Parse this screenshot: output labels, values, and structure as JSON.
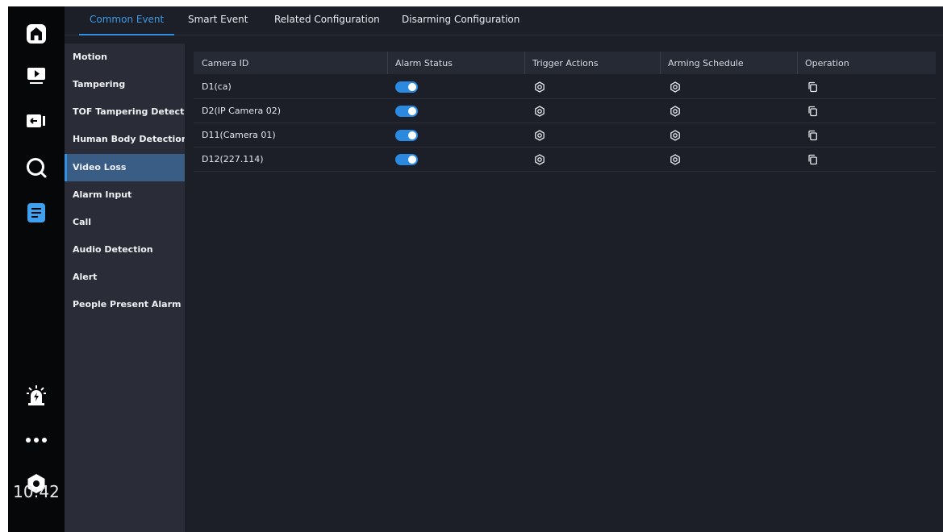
{
  "nav_icons": [
    "home-icon",
    "playback-icon",
    "backup-icon",
    "search-icon",
    "settings-menu-icon",
    "alarm-icon",
    "more-icon",
    "power-icon"
  ],
  "clock": "10:42",
  "tabs": [
    {
      "label": "Common Event",
      "active": true
    },
    {
      "label": "Smart Event",
      "active": false
    },
    {
      "label": "Related Configuration",
      "active": false
    },
    {
      "label": "Disarming Configuration",
      "active": false
    }
  ],
  "menu": [
    {
      "label": "Motion",
      "active": false
    },
    {
      "label": "Tampering",
      "active": false
    },
    {
      "label": "TOF Tampering Detect..",
      "active": false
    },
    {
      "label": "Human Body Detection",
      "active": false
    },
    {
      "label": "Video Loss",
      "active": true
    },
    {
      "label": "Alarm Input",
      "active": false
    },
    {
      "label": "Call",
      "active": false
    },
    {
      "label": "Audio Detection",
      "active": false
    },
    {
      "label": "Alert",
      "active": false
    },
    {
      "label": "People Present Alarm",
      "active": false
    }
  ],
  "table": {
    "headers": [
      "Camera ID",
      "Alarm Status",
      "Trigger Actions",
      "Arming Schedule",
      "Operation"
    ],
    "rows": [
      {
        "camera_id": "D1(ca)",
        "alarm_status": true
      },
      {
        "camera_id": "D2(IP Camera 02)",
        "alarm_status": true
      },
      {
        "camera_id": "D11(Camera 01)",
        "alarm_status": true
      },
      {
        "camera_id": "D12(227.114)",
        "alarm_status": true
      }
    ]
  },
  "colors": {
    "accent": "#2f8fe0",
    "background": "#1c1f28",
    "rail": "#060709",
    "menu": "#2a2d37",
    "menu_active": "#3a5d86"
  }
}
